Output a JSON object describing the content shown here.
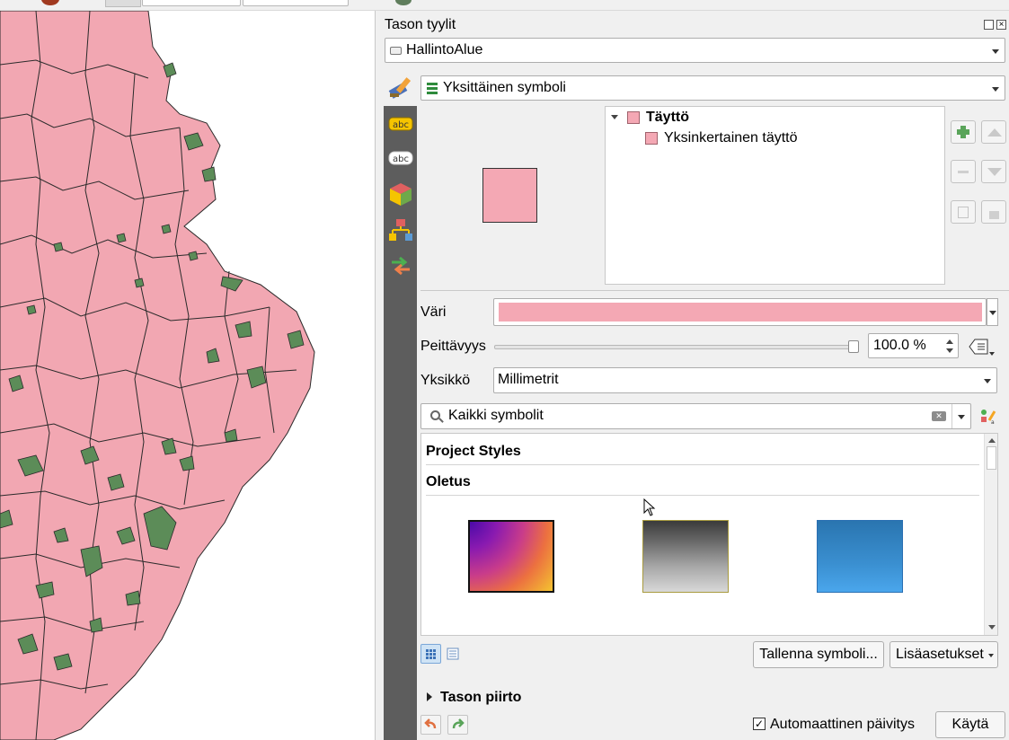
{
  "panel": {
    "title": "Tason tyylit",
    "layer": "HallintoAlue",
    "renderer": "Yksittäinen symboli"
  },
  "symbol_tree": {
    "root": "Täyttö",
    "child": "Yksinkertainen täyttö"
  },
  "fill": {
    "color_label": "Väri",
    "color": "#f4a8b4",
    "opacity_label": "Peittävyys",
    "opacity_value": "100.0 %",
    "opacity_level": 1.0,
    "unit_label": "Yksikkö",
    "unit_value": "Millimetrit"
  },
  "search": {
    "value": "Kaikki symbolit"
  },
  "library": {
    "groups": [
      "Project Styles",
      "Oletus"
    ]
  },
  "buttons": {
    "save_symbol": "Tallenna symboli...",
    "advanced": "Lisäasetukset",
    "apply": "Käytä"
  },
  "footer": {
    "layer_rendering": "Tason piirto",
    "auto_update": "Automaattinen päivitys",
    "auto_update_checked": true
  },
  "colors": {
    "region_fill": "#f2a7b2",
    "forest": "#5c8c58",
    "sidebar": "#5d5d5d"
  }
}
